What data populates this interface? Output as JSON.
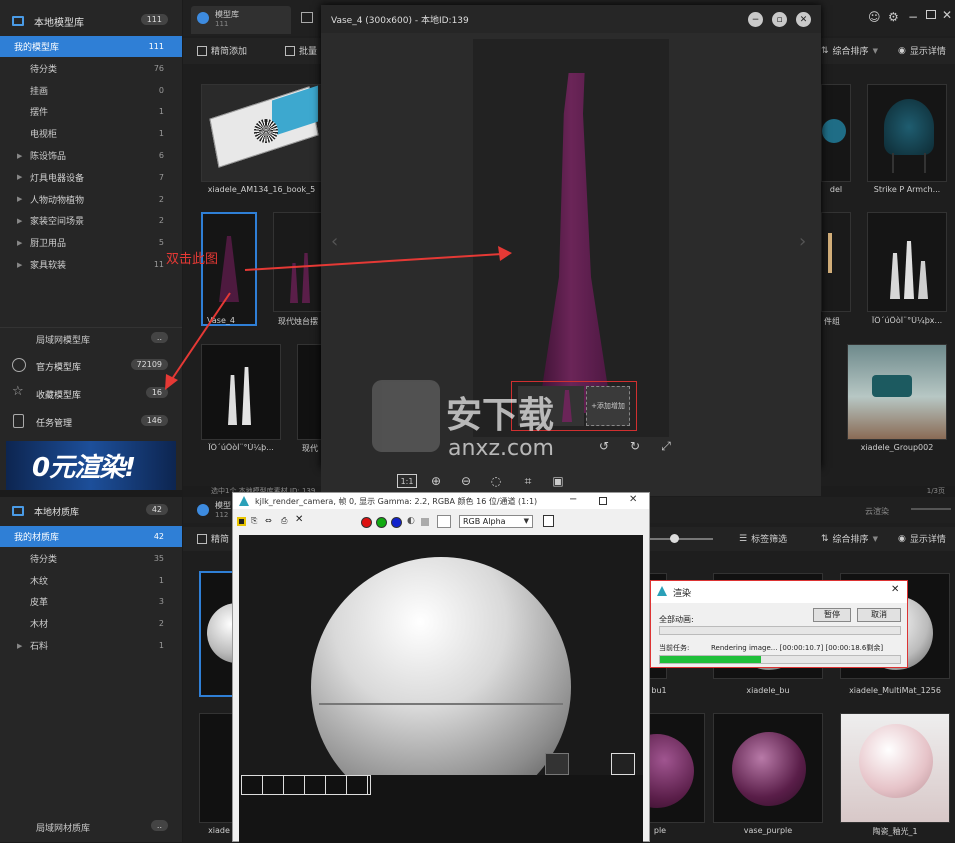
{
  "model_sidebar": {
    "header": {
      "label": "本地模型库",
      "count": "111"
    },
    "items": [
      {
        "label": "我的模型库",
        "count": "111",
        "selected": true,
        "arrow": false
      },
      {
        "label": "待分类",
        "count": "76",
        "arrow": false
      },
      {
        "label": "挂画",
        "count": "0",
        "arrow": false
      },
      {
        "label": "摆件",
        "count": "1",
        "arrow": false
      },
      {
        "label": "电视柜",
        "count": "1",
        "arrow": false
      },
      {
        "label": "陈设饰品",
        "count": "6",
        "arrow": true
      },
      {
        "label": "灯具电器设备",
        "count": "7",
        "arrow": true
      },
      {
        "label": "人物动物植物",
        "count": "2",
        "arrow": true
      },
      {
        "label": "家装空间场景",
        "count": "2",
        "arrow": true
      },
      {
        "label": "厨卫用品",
        "count": "5",
        "arrow": true
      },
      {
        "label": "家具软装",
        "count": "11",
        "arrow": true
      }
    ],
    "lan_label": "局域网模型库",
    "lan_badge": "..",
    "official": {
      "label": "官方模型库",
      "count": "72109"
    },
    "favorite": {
      "label": "收藏模型库",
      "count": "16"
    },
    "tasks": {
      "label": "任务管理",
      "count": "146"
    },
    "banner_text": "0元渲染!"
  },
  "material_sidebar": {
    "header": {
      "label": "本地材质库",
      "count": "42"
    },
    "items": [
      {
        "label": "我的材质库",
        "count": "42",
        "selected": true,
        "arrow": false
      },
      {
        "label": "待分类",
        "count": "35",
        "arrow": false
      },
      {
        "label": "木纹",
        "count": "1",
        "arrow": false
      },
      {
        "label": "皮革",
        "count": "3",
        "arrow": false
      },
      {
        "label": "木材",
        "count": "2",
        "arrow": false
      },
      {
        "label": "石料",
        "count": "1",
        "arrow": true
      }
    ],
    "lan_label": "局域网材质库",
    "lan_badge": ".."
  },
  "model_panel": {
    "tab_label": "模型库",
    "tab_count": "111",
    "toolbar": {
      "quick_add": "精简添加",
      "batch": "批量",
      "sort": "综合排序",
      "details": "显示详情"
    },
    "grid": [
      {
        "caption": "xiadele_AM134_16_book_5"
      },
      {
        "caption": "del"
      },
      {
        "caption": "Strike P Armch..."
      },
      {
        "caption": "Vase_4"
      },
      {
        "caption": "现代烛台摆"
      },
      {
        "caption": "件组"
      },
      {
        "caption": "ÏÖ´úÔòÌ¨°Ú¼þx..."
      },
      {
        "caption": "ÏÖ´úÔòÌ¨°Ú¼þ..."
      },
      {
        "caption": "现代"
      },
      {
        "caption": "xiadele_Group002"
      }
    ],
    "status_bar": "选中1个 本地模型库素材 ID: 139",
    "page": "1/3页"
  },
  "preview_window": {
    "title": "Vase_4 (300x600) - 本地ID:139",
    "thumb_add": "+添加增加",
    "zoom_label": "1:1"
  },
  "annotation": {
    "text": "双击此图"
  },
  "material_panel": {
    "tab_label": "模型",
    "tab_count": "112",
    "cloud_render": "云渲染",
    "toolbar": {
      "quick_add": "精简",
      "tag_filter": "标签筛选",
      "sort": "综合排序",
      "details": "显示详情"
    },
    "grid": [
      {
        "caption": "bu1"
      },
      {
        "caption": "xiadele_bu"
      },
      {
        "caption": "xiadele_MultiMat_1256"
      },
      {
        "caption": "xiade"
      },
      {
        "caption": "ple"
      },
      {
        "caption": "vase_purple"
      },
      {
        "caption": "陶瓷_釉光_1"
      }
    ]
  },
  "render_window": {
    "title": "kjlk_render_camera, 帧 0, 显示 Gamma: 2.2, RGBA 颜色 16 位/通道 (1:1)",
    "channel": "RGB Alpha"
  },
  "progress_dialog": {
    "title": "渲染",
    "all_frames_label": "全部动画:",
    "pause": "暂停",
    "cancel": "取消",
    "current_task_label": "当前任务:",
    "current_task_text": "Rendering image... [00:00:10.7] [00:00:18.6剩余]",
    "progress": 0.42
  },
  "watermark": {
    "text": "安下载",
    "sub": "anxz.com"
  },
  "colors": {
    "accent": "#2f7fd6",
    "progress": "#1fbf3a",
    "annotation": "#e53935",
    "vase": "#5a1e49"
  }
}
